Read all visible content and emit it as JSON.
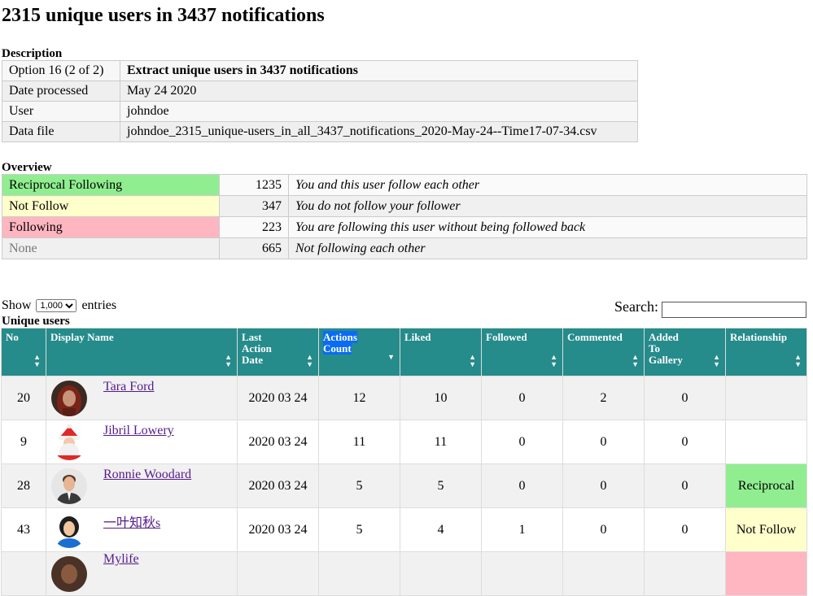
{
  "title": "2315 unique users in 3437 notifications",
  "description": {
    "label": "Description",
    "rows": [
      {
        "key": "Option 16 (2 of 2)",
        "value": "Extract unique users in 3437 notifications"
      },
      {
        "key": "Date processed",
        "value": "May 24 2020"
      },
      {
        "key": "User",
        "value": "johndoe"
      },
      {
        "key": "Data file",
        "value": "johndoe_2315_unique-users_in_all_3437_notifications_2020-May-24--Time17-07-34.csv"
      }
    ]
  },
  "overview": {
    "label": "Overview",
    "rows": [
      {
        "label": "Reciprocal Following",
        "count": "1235",
        "desc": "You and this user follow each other",
        "color": "#90ee90"
      },
      {
        "label": "Not Follow",
        "count": "347",
        "desc": "You do not follow your follower",
        "color": "#ffffcc"
      },
      {
        "label": "Following",
        "count": "223",
        "desc": "You are following this user without being followed back",
        "color": "#ffb6c1"
      },
      {
        "label": "None",
        "count": "665",
        "desc": "Not following each other",
        "color": "#f0f0f0"
      }
    ]
  },
  "controls": {
    "show_label": "Show",
    "entries_value": "1,000",
    "entries_label": "entries",
    "search_label": "Search:",
    "search_value": ""
  },
  "users": {
    "label": "Unique users",
    "header_color": "#258b8b",
    "columns": [
      "No",
      "Display Name",
      "Last Action Date",
      "Actions Count",
      "Liked",
      "Followed",
      "Commented",
      "Added To Gallery",
      "Relationship"
    ],
    "sorted_column": "Actions Count",
    "rows": [
      {
        "no": "20",
        "name": "Tara Ford",
        "date": "2020 03 24",
        "actions": "12",
        "liked": "10",
        "followed": "0",
        "commented": "2",
        "gallery": "0",
        "relationship": "",
        "avatar": "woman-hooded-avatar-icon"
      },
      {
        "no": "9",
        "name": "Jibril Lowery",
        "date": "2020 03 24",
        "actions": "11",
        "liked": "11",
        "followed": "0",
        "commented": "0",
        "gallery": "0",
        "relationship": "",
        "avatar": "santa-avatar-icon"
      },
      {
        "no": "28",
        "name": "Ronnie Woodard",
        "date": "2020 03 24",
        "actions": "5",
        "liked": "5",
        "followed": "0",
        "commented": "0",
        "gallery": "0",
        "relationship": "Reciprocal",
        "avatar": "man-suit-avatar-icon"
      },
      {
        "no": "43",
        "name": "一叶知秋s",
        "date": "2020 03 24",
        "actions": "5",
        "liked": "4",
        "followed": "1",
        "commented": "0",
        "gallery": "0",
        "relationship": "Not Follow",
        "avatar": "woman-avatar-icon"
      },
      {
        "no": "",
        "name": "Mylife",
        "date": "",
        "actions": "",
        "liked": "",
        "followed": "",
        "commented": "",
        "gallery": "",
        "relationship": "",
        "avatar": "partial-avatar-icon"
      }
    ]
  }
}
